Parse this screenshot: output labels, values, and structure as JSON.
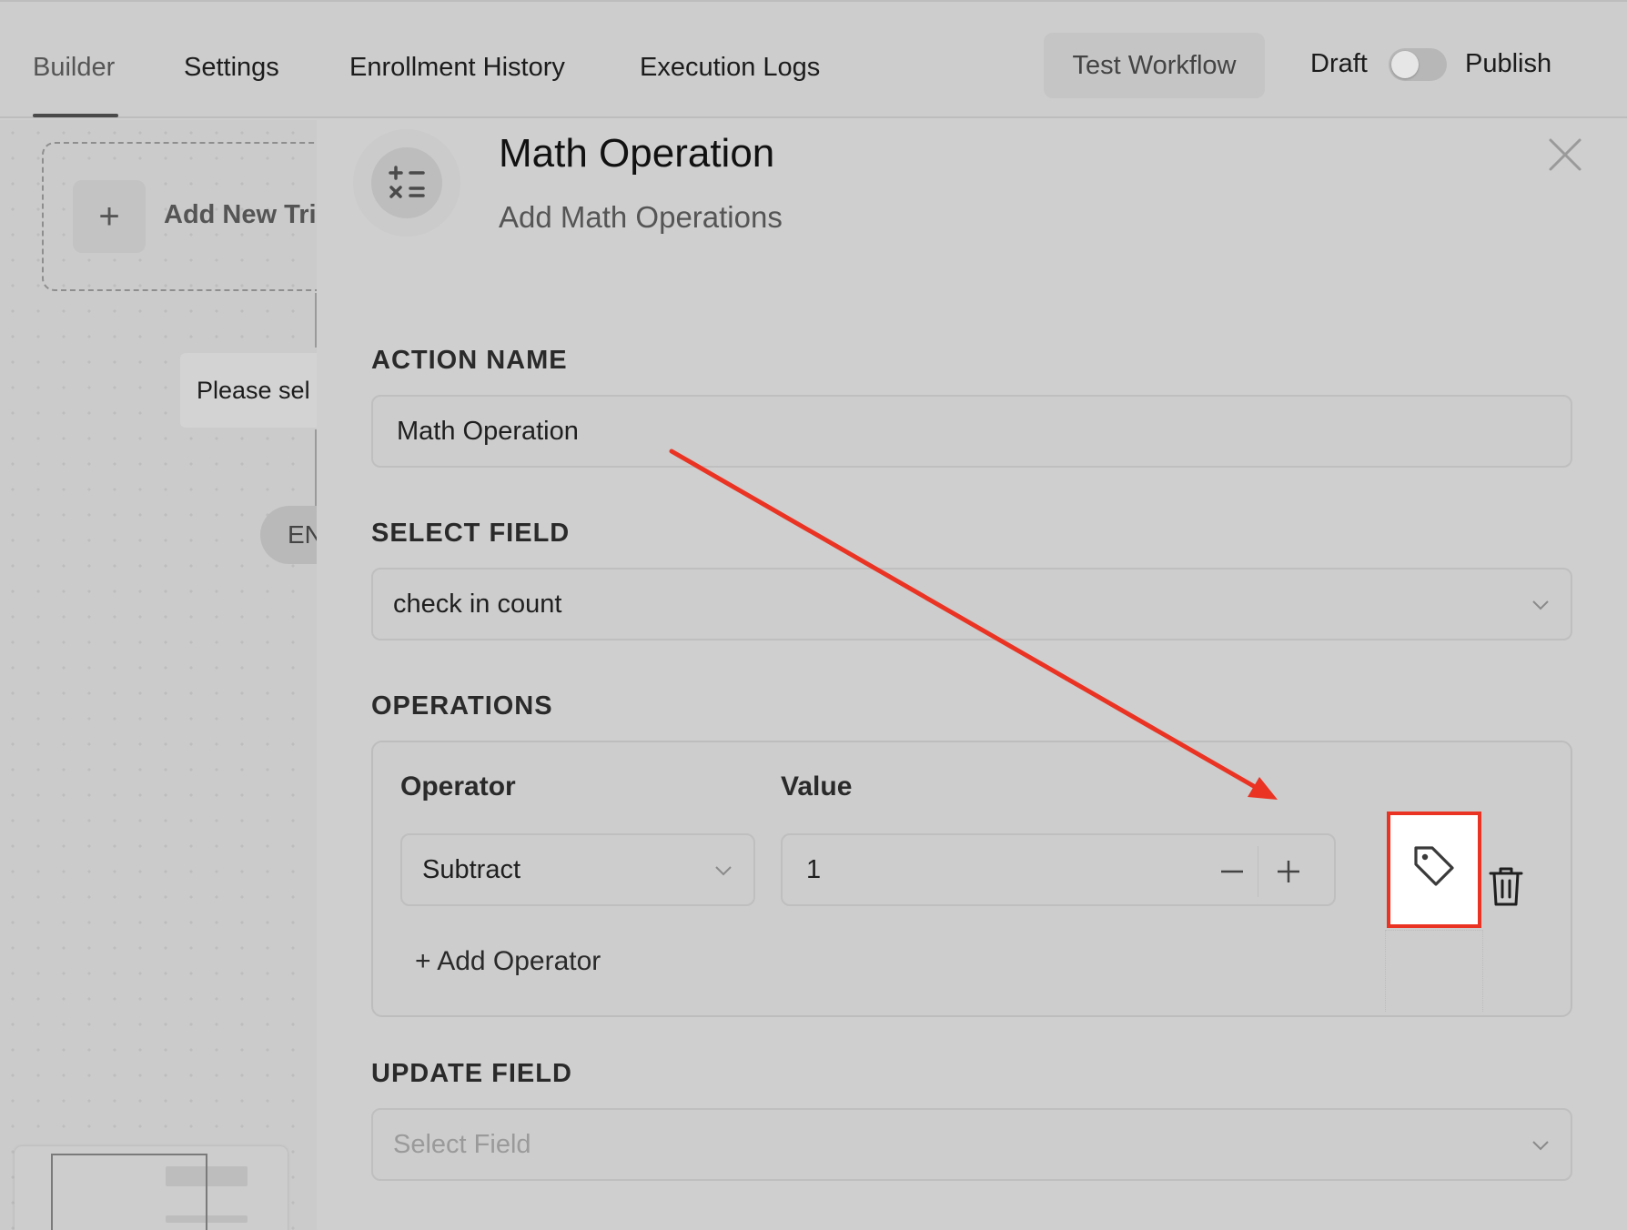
{
  "tabs": [
    {
      "label": "Builder",
      "active": true
    },
    {
      "label": "Settings",
      "active": false
    },
    {
      "label": "Enrollment History",
      "active": false
    },
    {
      "label": "Execution Logs",
      "active": false
    }
  ],
  "header_actions": {
    "test_workflow_label": "Test Workflow",
    "draft_label": "Draft",
    "publish_label": "Publish",
    "publish_toggle_on": false
  },
  "canvas": {
    "trigger_card_label": "Add New Tri",
    "trigger_plus": "+",
    "please_select_text": "Please sel",
    "end_pill_text": "EN"
  },
  "panel": {
    "title": "Math Operation",
    "subtitle": "Add Math Operations",
    "icon": "math-operators-icon",
    "action_name": {
      "label": "ACTION NAME",
      "value": "Math Operation"
    },
    "select_field": {
      "label": "SELECT FIELD",
      "value": "check in count"
    },
    "operations": {
      "label": "OPERATIONS",
      "operator_column": "Operator",
      "value_column": "Value",
      "rows": [
        {
          "operator": "Subtract",
          "value": "1"
        }
      ],
      "add_operator_label": "+ Add Operator"
    },
    "update_field": {
      "label": "UPDATE FIELD",
      "placeholder": "Select Field"
    }
  },
  "annotation": {
    "highlight_color": "#ea3323",
    "target": "tag-icon"
  },
  "colors": {
    "background": "#cfcfcf",
    "accent_red": "#ea3323"
  }
}
